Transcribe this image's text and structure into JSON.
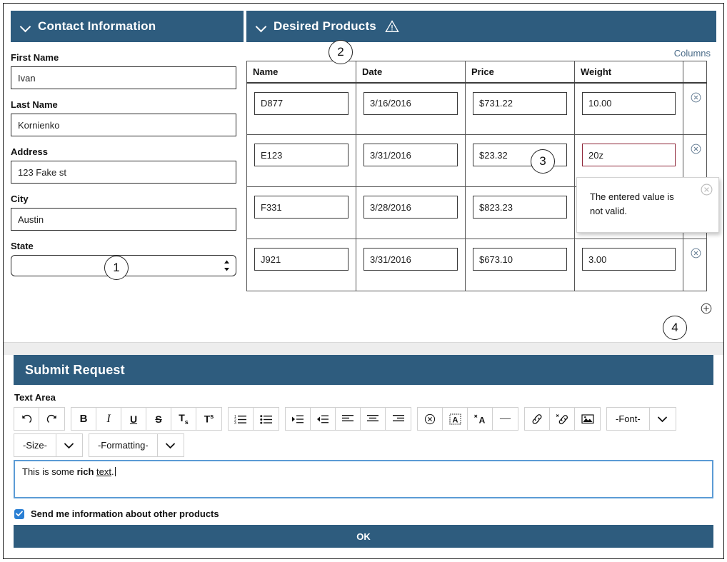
{
  "contact": {
    "title": "Contact Information",
    "chevron_icon": "chevron-down-icon",
    "fields": [
      {
        "label": "First Name",
        "value": "Ivan",
        "type": "text"
      },
      {
        "label": "Last Name",
        "value": "Kornienko",
        "type": "text"
      },
      {
        "label": "Address",
        "value": "123 Fake st",
        "type": "text"
      },
      {
        "label": "City",
        "value": "Austin",
        "type": "text"
      },
      {
        "label": "State",
        "value": "",
        "type": "select"
      }
    ]
  },
  "products": {
    "title": "Desired Products",
    "chevron_icon": "chevron-down-icon",
    "warning_icon": "warning-triangle-icon",
    "columns_link": "Columns",
    "headers": [
      "Name",
      "Date",
      "Price",
      "Weight",
      ""
    ],
    "rows": [
      {
        "name": "D877",
        "date": "3/16/2016",
        "price": "$731.22",
        "weight": "10.00",
        "weight_invalid": false,
        "weight_hidden": false
      },
      {
        "name": "E123",
        "date": "3/31/2016",
        "price": "$23.32",
        "weight": "20z",
        "weight_invalid": true,
        "weight_hidden": false
      },
      {
        "name": "F331",
        "date": "3/28/2016",
        "price": "$823.23",
        "weight": "",
        "weight_invalid": false,
        "weight_hidden": true
      },
      {
        "name": "J921",
        "date": "3/31/2016",
        "price": "$673.10",
        "weight": "3.00",
        "weight_invalid": false,
        "weight_hidden": false
      }
    ],
    "delete_icon": "delete-row-icon",
    "add_icon": "add-row-icon"
  },
  "error_popup": {
    "message": "The entered value is not valid.",
    "close_icon": "close-icon"
  },
  "callouts": [
    {
      "number": "1"
    },
    {
      "number": "2"
    },
    {
      "number": "3"
    },
    {
      "number": "4"
    }
  ],
  "submit": {
    "title": "Submit Request",
    "textarea_label": "Text Area",
    "toolbar_row1": [
      {
        "group": 1,
        "icon": "undo-icon",
        "label": "↶"
      },
      {
        "group": 1,
        "icon": "redo-icon",
        "label": "↷"
      },
      {
        "group": 2,
        "icon": "bold-icon",
        "label": "B"
      },
      {
        "group": 2,
        "icon": "italic-icon",
        "label": "I"
      },
      {
        "group": 2,
        "icon": "underline-icon",
        "label": "U"
      },
      {
        "group": 2,
        "icon": "strikethrough-icon",
        "label": "S"
      },
      {
        "group": 2,
        "icon": "subscript-icon",
        "label": "T"
      },
      {
        "group": 2,
        "icon": "superscript-icon",
        "label": "T"
      },
      {
        "group": 3,
        "icon": "ordered-list-icon",
        "label": ""
      },
      {
        "group": 3,
        "icon": "unordered-list-icon",
        "label": ""
      },
      {
        "group": 4,
        "icon": "indent-icon",
        "label": ""
      },
      {
        "group": 4,
        "icon": "outdent-icon",
        "label": ""
      },
      {
        "group": 4,
        "icon": "align-left-icon",
        "label": ""
      },
      {
        "group": 4,
        "icon": "align-center-icon",
        "label": ""
      },
      {
        "group": 4,
        "icon": "align-right-icon",
        "label": ""
      },
      {
        "group": 5,
        "icon": "clear-formatting-icon",
        "label": ""
      },
      {
        "group": 5,
        "icon": "text-color-icon",
        "label": "A"
      },
      {
        "group": 5,
        "icon": "remove-format-icon",
        "label": "A"
      },
      {
        "group": 5,
        "icon": "horizontal-rule-icon",
        "label": "—"
      },
      {
        "group": 6,
        "icon": "link-icon",
        "label": ""
      },
      {
        "group": 6,
        "icon": "unlink-icon",
        "label": ""
      },
      {
        "group": 6,
        "icon": "image-icon",
        "label": ""
      }
    ],
    "font_dropdown": "-Font-",
    "size_dropdown": "-Size-",
    "formatting_dropdown": "-Formatting-",
    "caret_icon": "chevron-down-icon",
    "editor_text": {
      "plain1": "This is some ",
      "bold": "rich",
      "space": " ",
      "underline": "text",
      "plain2": "."
    },
    "checkbox_label": "Send me information about other products",
    "checkbox_checked": true,
    "check_icon": "checkmark-icon",
    "ok_label": "OK"
  },
  "colors": {
    "header_blue": "#2e5c7e",
    "link_blue": "#4a6b88",
    "invalid_red": "#8d2437",
    "focus_blue": "#5b9bd5",
    "checkbox_blue": "#2a7fd4"
  }
}
